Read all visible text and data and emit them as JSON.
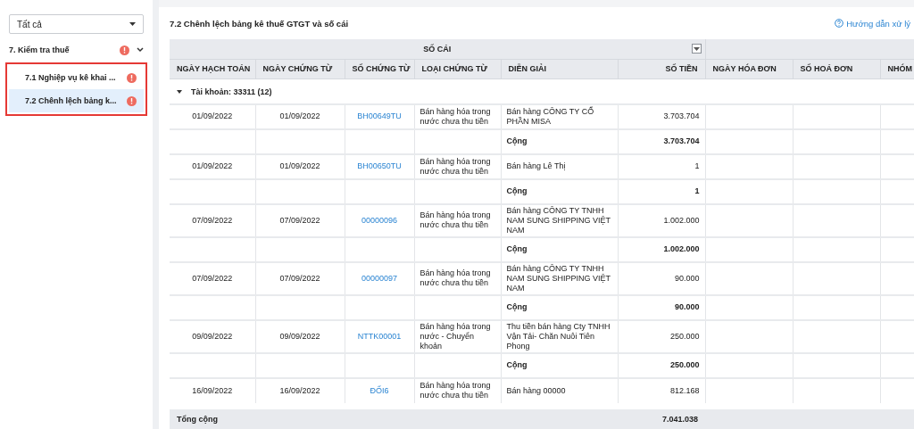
{
  "sidebar": {
    "filter": {
      "value": "Tất cả"
    },
    "tree": [
      {
        "label": "7. Kiểm tra thuế",
        "warning": true,
        "expanded": true,
        "children": [
          {
            "label": "7.1 Nghiệp vụ kê khai ...",
            "warning": true,
            "selected": false
          },
          {
            "label": "7.2 Chênh lệch bảng k...",
            "warning": true,
            "selected": true
          }
        ]
      }
    ]
  },
  "content": {
    "title": "7.2 Chênh lệch bảng kê thuế GTGT và số cái",
    "help_link": "Hướng dẫn xử lý",
    "table": {
      "group_header": "SỐ CÁI",
      "columns": [
        "NGÀY HẠCH TOÁN",
        "NGÀY CHỨNG TỪ",
        "SỐ CHỨNG TỪ",
        "LOẠI CHỨNG TỪ",
        "DIỄN GIẢI",
        "SỐ TIỀN",
        "NGÀY HÓA ĐƠN",
        "SỐ HOÁ ĐƠN",
        "NHÓM"
      ],
      "groups": [
        {
          "label": "Tài khoản: 33311 (12)",
          "expanded": true,
          "rows": [
            {
              "kind": "entry",
              "cells": [
                "01/09/2022",
                "01/09/2022",
                "BH00649TU",
                "Bán hàng hóa trong nước chưa thu tiền",
                "Bán hàng CÔNG TY CỔ PHẦN MISA",
                "3.703.704"
              ]
            },
            {
              "kind": "subtotal",
              "label": "Cộng",
              "amount": "3.703.704"
            },
            {
              "kind": "entry",
              "cells": [
                "01/09/2022",
                "01/09/2022",
                "BH00650TU",
                "Bán hàng hóa trong nước chưa thu tiền",
                "Bán hàng Lê Thị",
                "1"
              ]
            },
            {
              "kind": "subtotal",
              "label": "Cộng",
              "amount": "1"
            },
            {
              "kind": "entry",
              "cells": [
                "07/09/2022",
                "07/09/2022",
                "00000096",
                "Bán hàng hóa trong nước chưa thu tiền",
                "Bán hàng CÔNG TY TNHH NAM SUNG SHIPPING VIỆT NAM",
                "1.002.000"
              ]
            },
            {
              "kind": "subtotal",
              "label": "Cộng",
              "amount": "1.002.000"
            },
            {
              "kind": "entry",
              "cells": [
                "07/09/2022",
                "07/09/2022",
                "00000097",
                "Bán hàng hóa trong nước chưa thu tiền",
                "Bán hàng CÔNG TY TNHH NAM SUNG SHIPPING VIỆT NAM",
                "90.000"
              ]
            },
            {
              "kind": "subtotal",
              "label": "Cộng",
              "amount": "90.000"
            },
            {
              "kind": "entry",
              "cells": [
                "09/09/2022",
                "09/09/2022",
                "NTTK00001",
                "Bán hàng hóa trong nước - Chuyển khoản",
                "Thu tiền bán hàng Cty TNHH Vận Tải- Chăn Nuôi Tiên Phong",
                "250.000"
              ]
            },
            {
              "kind": "subtotal",
              "label": "Cộng",
              "amount": "250.000"
            },
            {
              "kind": "entry",
              "cells": [
                "16/09/2022",
                "16/09/2022",
                "ĐỐI6",
                "Bán hàng hóa trong nước chưa thu tiền",
                "Bán hàng 00000",
                "812.168"
              ]
            }
          ]
        }
      ],
      "footer": {
        "label": "Tổng cộng",
        "amount": "7.041.038"
      }
    }
  }
}
